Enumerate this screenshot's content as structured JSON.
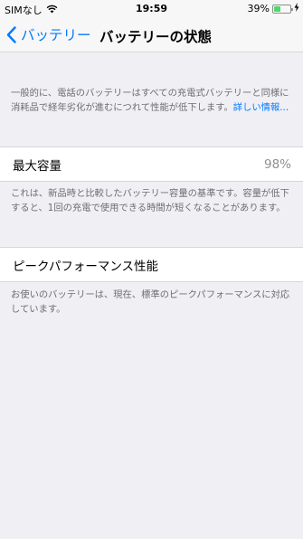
{
  "status_bar": {
    "carrier": "SIMなし",
    "time": "19:59",
    "battery_percent": "39%",
    "battery_level": 0.39,
    "accent_green": "#4cd964"
  },
  "nav": {
    "back_label": "バッテリー",
    "title": "バッテリーの状態",
    "accent": "#007aff"
  },
  "intro": {
    "text": "一般的に、電話のバッテリーはすべての充電式バッテリーと同様に消耗品で経年劣化が進むにつれて性能が低下します。",
    "link": "詳しい情報..."
  },
  "max_capacity": {
    "label": "最大容量",
    "value": "98%",
    "footer": "これは、新品時と比較したバッテリー容量の基準です。容量が低下すると、1回の充電で使用できる時間が短くなることがあります。"
  },
  "peak_performance": {
    "label": "ピークパフォーマンス性能",
    "footer": "お使いのバッテリーは、現在、標準のピークパフォーマンスに対応しています。"
  }
}
